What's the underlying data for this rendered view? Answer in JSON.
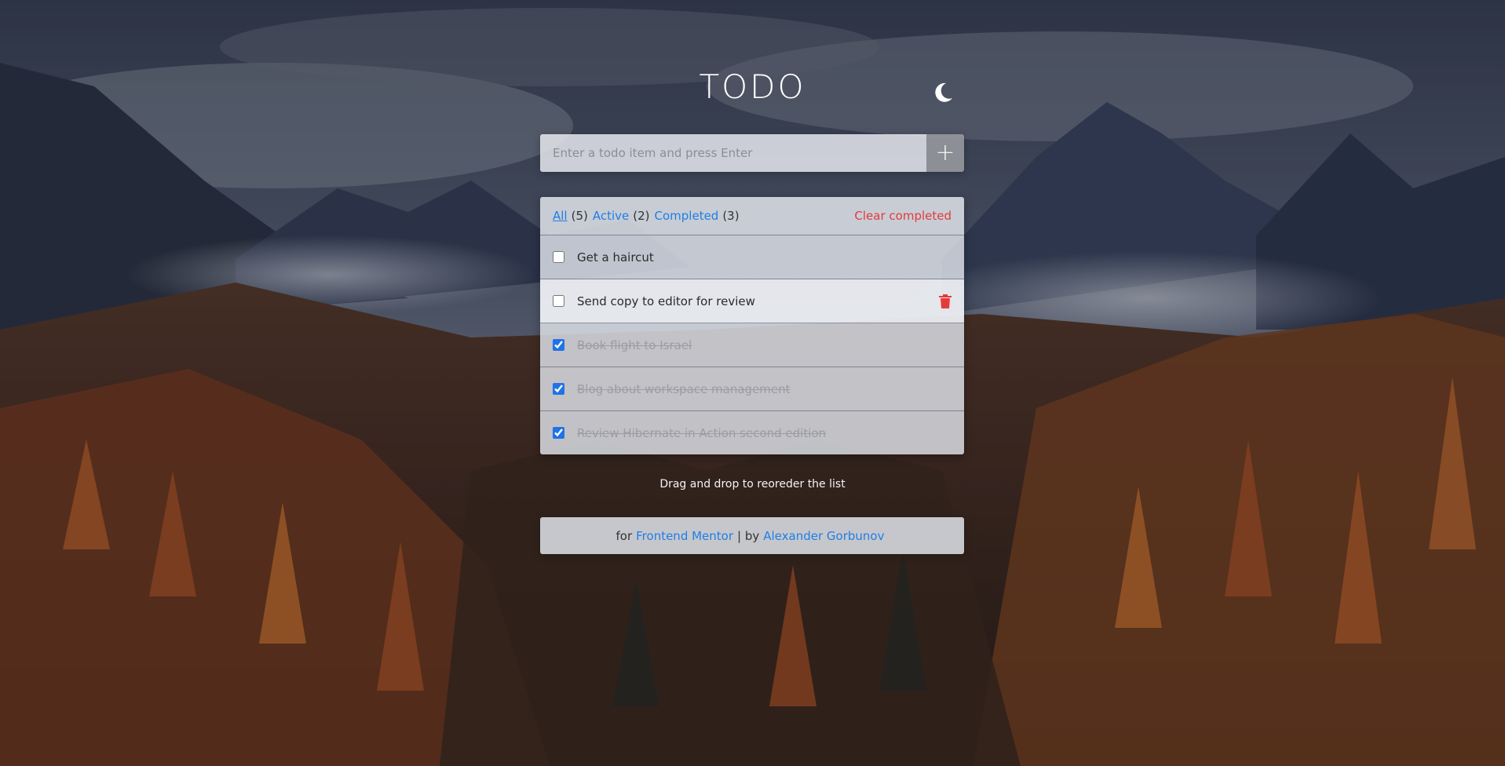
{
  "app": {
    "title": "TODO",
    "theme_icon": "moon-icon"
  },
  "input": {
    "placeholder": "Enter a todo item and press Enter",
    "value": "",
    "add_label": "+"
  },
  "filters": {
    "all_label": "All",
    "all_count": "(5)",
    "active_label": "Active",
    "active_count": "(2)",
    "completed_label": "Completed",
    "completed_count": "(3)",
    "clear_label": "Clear completed",
    "selected": "All"
  },
  "todos": [
    {
      "text": "Get a haircut",
      "completed": false
    },
    {
      "text": "Send copy to editor for review",
      "completed": false
    },
    {
      "text": "Book flight to Israel",
      "completed": true
    },
    {
      "text": "Blog about workspace management",
      "completed": true
    },
    {
      "text": "Review Hibernate in Action second edition",
      "completed": true
    }
  ],
  "hint": "Drag and drop to reoreder the list",
  "footer": {
    "prefix": "for",
    "link1": "Frontend Mentor",
    "separator": "| by",
    "link2": "Alexander Gorbunov"
  },
  "colors": {
    "accent": "#1f7ee6",
    "danger": "#e53a3a"
  }
}
